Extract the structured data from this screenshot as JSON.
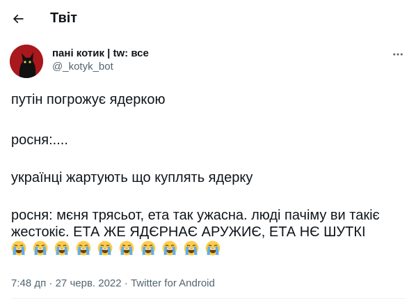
{
  "header": {
    "back_icon": "arrow-left-icon",
    "title": "Твіт"
  },
  "tweet": {
    "author": {
      "display_name": "пані котик | tw: все",
      "handle": "@_kotyk_bot",
      "avatar_icon": "black-cat-avatar"
    },
    "more_icon": "more-dots-icon",
    "text": {
      "p1": "путін погрожує ядеркою",
      "p2": "росня:....",
      "p3": "українці жартують що куплять ядерку",
      "p4": "росня: мєня трясьот, ета так ужасна. люді пачіму ви такіє жестокіє. ЕТА ЖЕ ЯДЄРНАЄ АРУЖИЄ, ЕТА НЄ ШУТКІ"
    },
    "emoji_name": "loudly-crying-face-emoji",
    "emoji_count": 10,
    "time": "7:48 дп",
    "separator": "·",
    "date": "27 черв. 2022",
    "source": "Twitter for Android"
  },
  "colors": {
    "text": "#0f1419",
    "secondary": "#536471",
    "avatar_bg": "#a8181d",
    "emoji_face": "#FFCC4D",
    "emoji_tears": "#5DADEC"
  }
}
